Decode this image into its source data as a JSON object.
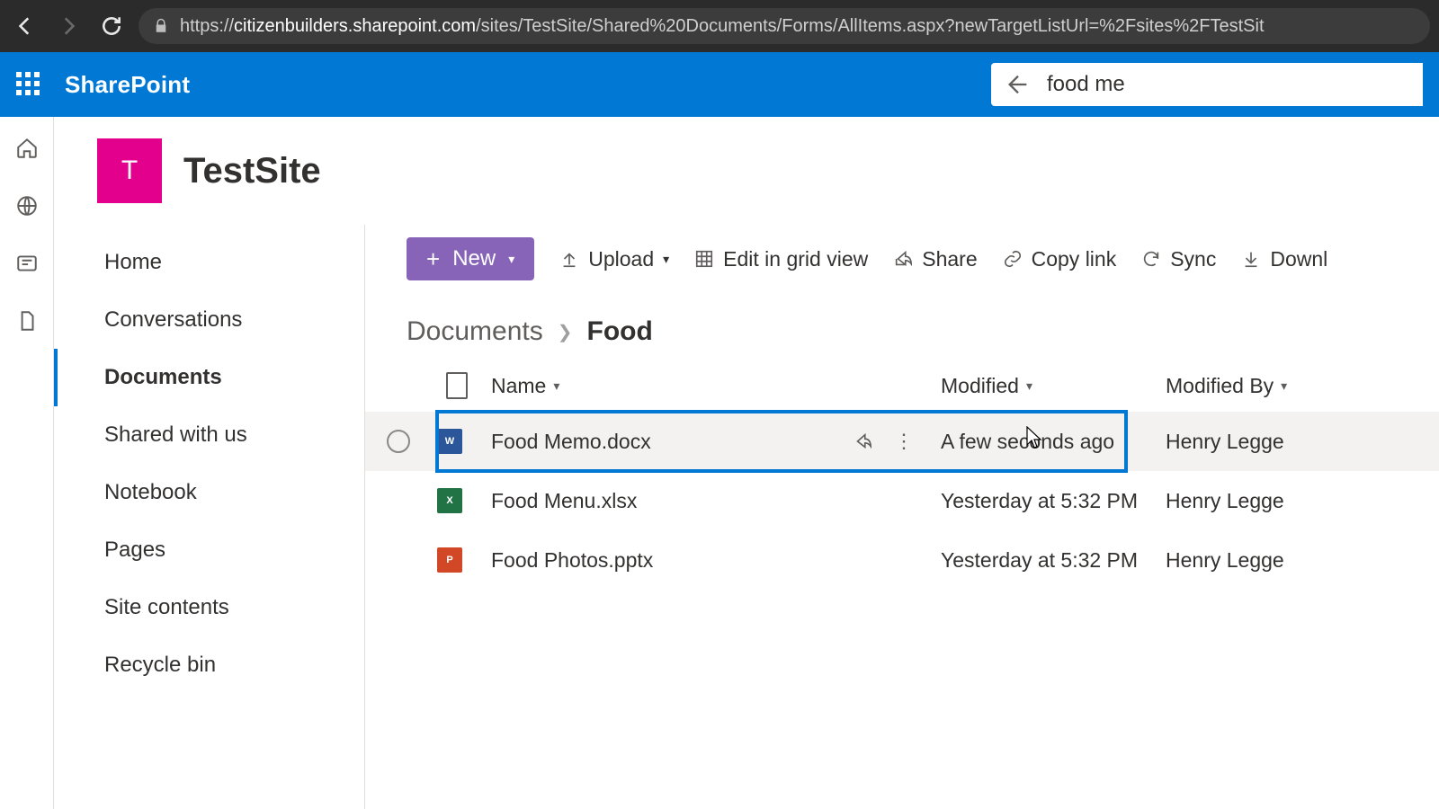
{
  "browser": {
    "url_host": "citizenbuilders.sharepoint.com",
    "url_prefix": "https://",
    "url_path": "/sites/TestSite/Shared%20Documents/Forms/AllItems.aspx?newTargetListUrl=%2Fsites%2FTestSit"
  },
  "suite": {
    "brand": "SharePoint",
    "search_value": "food me"
  },
  "site": {
    "tile_initial": "T",
    "title": "TestSite"
  },
  "left_nav": {
    "items": [
      {
        "label": "Home"
      },
      {
        "label": "Conversations"
      },
      {
        "label": "Documents",
        "active": true
      },
      {
        "label": "Shared with us"
      },
      {
        "label": "Notebook"
      },
      {
        "label": "Pages"
      },
      {
        "label": "Site contents"
      },
      {
        "label": "Recycle bin"
      }
    ]
  },
  "commands": {
    "new": "New",
    "upload": "Upload",
    "edit_grid": "Edit in grid view",
    "share": "Share",
    "copy_link": "Copy link",
    "sync": "Sync",
    "download": "Downl"
  },
  "breadcrumb": {
    "root": "Documents",
    "current": "Food"
  },
  "columns": {
    "name": "Name",
    "modified": "Modified",
    "modified_by": "Modified By"
  },
  "rows": [
    {
      "type": "word",
      "name": "Food Memo.docx",
      "modified": "A few seconds ago",
      "modified_by": "Henry Legge",
      "hover": true,
      "highlighted": true
    },
    {
      "type": "excel",
      "name": "Food Menu.xlsx",
      "modified": "Yesterday at 5:32 PM",
      "modified_by": "Henry Legge"
    },
    {
      "type": "ppt",
      "name": "Food Photos.pptx",
      "modified": "Yesterday at 5:32 PM",
      "modified_by": "Henry Legge"
    }
  ],
  "colors": {
    "accent": "#0078d4",
    "new_button": "#8764b8",
    "site_tile": "#e3008c"
  }
}
